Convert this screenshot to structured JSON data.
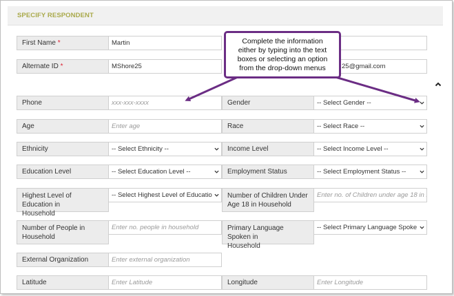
{
  "panel": {
    "title": "SPECIFY RESPONDENT"
  },
  "callout": {
    "line1": "Complete the information",
    "line2": "either by typing into the text",
    "line3": "boxes or selecting an option",
    "line4": "from the drop-down menus"
  },
  "fields": {
    "first_name": {
      "label": "First Name",
      "required": "*",
      "value": "Martin"
    },
    "alternate_id": {
      "label": "Alternate ID",
      "required": "*",
      "value": "MShore25"
    },
    "email_partial": {
      "value": "25@gmail.com"
    },
    "phone": {
      "label": "Phone",
      "placeholder": "xxx-xxx-xxxx"
    },
    "gender": {
      "label": "Gender",
      "selected": "-- Select Gender --"
    },
    "age": {
      "label": "Age",
      "placeholder": "Enter age"
    },
    "race": {
      "label": "Race",
      "selected": "-- Select Race --"
    },
    "ethnicity": {
      "label": "Ethnicity",
      "selected": "-- Select Ethnicity --"
    },
    "income": {
      "label": "Income Level",
      "selected": "-- Select Income Level --"
    },
    "education": {
      "label": "Education Level",
      "selected": "-- Select Education Level --"
    },
    "employment": {
      "label": "Employment Status",
      "selected": "-- Select Employment Status --"
    },
    "highest_edu": {
      "label_line1": "Highest Level of Education in",
      "label_line2": "Household",
      "selected": "-- Select Highest Level of Educatio"
    },
    "children": {
      "label_line1": "Number of Children Under",
      "label_line2": "Age 18 in Household",
      "placeholder": "Enter no. of Children under age 18 in h"
    },
    "people": {
      "label_line1": "Number of People in",
      "label_line2": "Household",
      "placeholder": "Enter no. people in household"
    },
    "language": {
      "label_line1": "Primary Language Spoken in",
      "label_line2": "Household",
      "selected": "-- Select Primary Language Spoke"
    },
    "external_org": {
      "label": "External Organization",
      "placeholder": "Enter external organization"
    },
    "latitude": {
      "label": "Latitude",
      "placeholder": "Enter Latitude"
    },
    "longitude": {
      "label": "Longitude",
      "placeholder": "Enter Longitude"
    }
  },
  "colors": {
    "accent": "#a9a94a",
    "callout_border": "#6b2d84",
    "required": "#dd2233"
  },
  "icons": {
    "select_arrow": "chevron-down-icon",
    "scroll_up": "chevron-up-icon"
  }
}
